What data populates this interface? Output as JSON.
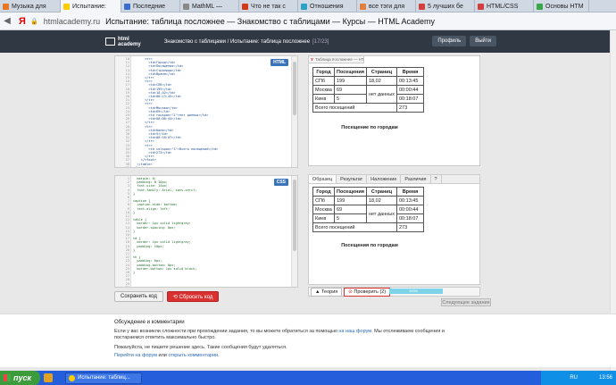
{
  "browser_tabs": [
    {
      "label": "Музыка для",
      "color": "#e87722"
    },
    {
      "label": "Испытание:",
      "color": "#ffcc00",
      "active": true
    },
    {
      "label": "Последние",
      "color": "#3b6ccf"
    },
    {
      "label": "MathML —",
      "color": "#888888"
    },
    {
      "label": "Что не так с",
      "color": "#d43a1a"
    },
    {
      "label": "Отношения",
      "color": "#2aa2c8"
    },
    {
      "label": "все тэги для",
      "color": "#e0803c"
    },
    {
      "label": "5 лучших бе",
      "color": "#d33e3e"
    },
    {
      "label": "HTML/CSS",
      "color": "#d33e3e"
    },
    {
      "label": "Основы HTM",
      "color": "#39a848"
    }
  ],
  "address_bar": {
    "engine_letter": "Я",
    "host": "htmlacademy.ru",
    "title": "Испытание: таблица посложнее — Знакомство с таблицами — Курсы — HTML Academy"
  },
  "site_header": {
    "logo_line1": "html",
    "logo_line2": "academy",
    "breadcrumb": "Знакомство с таблицами / Испытание: таблица посложнее",
    "counter": "[17/23]",
    "profile": "Профиль",
    "logout": "Выйти"
  },
  "html_editor": {
    "tag": "HTML",
    "line_numbers": "10\n11\n12\n13\n14\n15\n16\n17\n18\n19\n20\n21\n22\n23\n24\n25\n26\n27\n28\n29\n30\n31\n32\n33\n34\n35\n36\n37\n38\n39",
    "code": "      <tr>\n        <td>Город</td>\n        <td>Посещения</td>\n        <td>Страницы</td>\n        <td>Время</td>\n      </tr>\n      <tr>\n        <td>СПб</td>\n        <td>199</td>\n        <td>18,02</td>\n        <td>00:13:45</td>\n      </tr>\n      <tr>\n        <td>Москва</td>\n        <td>69</td>\n        <td rowspan=\"2\">нет данных</td>\n        <td>00:00:44</td>\n      </tr>\n      <tr>\n        <td>Киев</td>\n        <td>5</td>\n        <td>00:18:07</td>\n      </tr>\n      <tr>\n        <td colspan=\"3\">Всего посещений</td>\n        <td>273</td>\n      </tr>\n    </tfoot>\n  </table>\n</body>"
  },
  "css_editor": {
    "tag": "CSS",
    "line_numbers": "1\n2\n3\n4\n5\n6\n7\n8\n9\n10\n11\n12\n13\n14\n15\n16\n17\n18\n19\n20\n21\n22\n23\n24\n25\n26\n27\n28\n29\n30",
    "code": "  margin: 0;\n  padding: 0 10px;\n  font-size: 14px;\n  font-family: Arial, sans-serif;\n}\n\ncaption {\n  caption-side: bottom;\n  text-align: left;\n}\n\ntable {\n  border: 1px solid lightgray;\n  border-spacing: 0px;\n}\n\ntd {\n  border: 1px solid lightgray;\n  padding: 10px;\n}\n\nth {\n  padding: 0px;\n  padding-bottom: 0px;\n  border-bottom: 1px solid black;\n}\n"
  },
  "buttons": {
    "save": "Сохранить код",
    "reset": "Сбросить код"
  },
  "preview_top": {
    "tab_label": "Таблица посложнее — HTML Acad",
    "headers": [
      "Город",
      "Посещения",
      "Страниц",
      "Время"
    ],
    "rows": [
      [
        "СПб",
        "199",
        "18,02",
        "00:13:45"
      ],
      [
        "Москва",
        "69",
        "нет данных",
        "00:00:44"
      ],
      [
        "Киев",
        "5",
        "",
        "00:18:07"
      ]
    ],
    "total_label": "Всего посещений",
    "total_value": "273",
    "caption": "Посещение по городам"
  },
  "compare_tabs": [
    "Образец",
    "Результат",
    "Наложение",
    "Различия",
    "?"
  ],
  "preview_bottom": {
    "headers": [
      "Город",
      "Посещения",
      "Страниц",
      "Время"
    ],
    "rows": [
      [
        "СПб",
        "199",
        "18,02",
        "00:13:45"
      ],
      [
        "Москва",
        "69",
        "нет данных",
        "00:00:44"
      ],
      [
        "Киев",
        "5",
        "",
        "00:18:07"
      ]
    ],
    "total_label": "Всего посещений",
    "total_value": "273",
    "caption": "Посещения по городам"
  },
  "bottom_tabs": {
    "theory": "Теория",
    "check": "Проверить (2)",
    "progress_label": "100%",
    "next": "Следующее задание"
  },
  "comments": {
    "heading": "Обсуждение и комментарии",
    "p1_before": "Если у вас возникли сложности при прохождении задания, то вы можете обратиться за помощью ",
    "p1_link": "на наш форум",
    "p1_after": ". Мы отслеживаем сообщения и постараемся ответить максимально быстро.",
    "p2": "Пожалуйста, не пишите решение здесь. Такие сообщения будут удаляться.",
    "link1": "Перейти на форум",
    "or": " или ",
    "link2": "открыть комментарии",
    "dot": "."
  },
  "taskbar": {
    "start": "пуск",
    "item": "Испытание: таблиц...",
    "lang": "RU",
    "time": "13:56"
  }
}
